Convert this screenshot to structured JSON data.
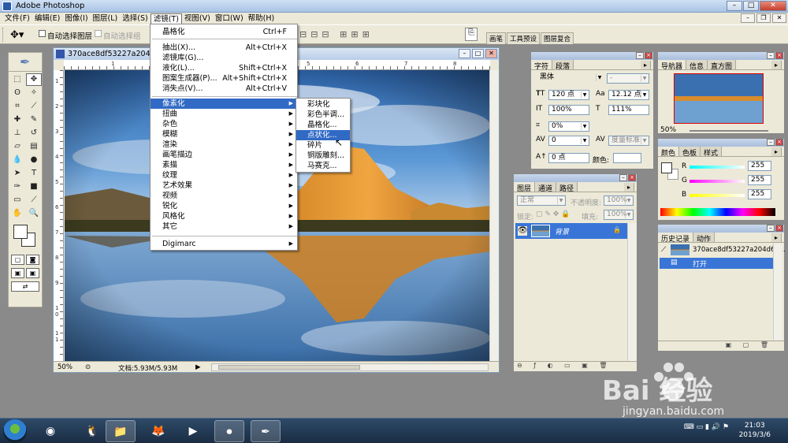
{
  "app": {
    "title": "Adobe Photoshop"
  },
  "menubar": {
    "items": [
      "文件(F)",
      "编辑(E)",
      "图像(I)",
      "图层(L)",
      "选择(S)",
      "滤镜(T)",
      "视图(V)",
      "窗口(W)",
      "帮助(H)"
    ],
    "active": "滤镜(T)"
  },
  "options": {
    "auto_select_layer": "自动选择图层",
    "auto_select_group": "自动选择组",
    "palette_tabs": [
      "画笔",
      "工具预设",
      "图层复合"
    ]
  },
  "document": {
    "title": "370ace8df53227a204d64...",
    "zoom": "50%",
    "doc_size": "文档:5.93M/5.93M",
    "ruler_top": [
      "1",
      "2",
      "3",
      "4",
      "5",
      "6",
      "7",
      "8"
    ],
    "ruler_left": [
      "1",
      "2",
      "3",
      "4",
      "5",
      "6",
      "7",
      "8",
      "9",
      "1 0",
      "1 1"
    ]
  },
  "filter_menu": {
    "items": [
      {
        "label": "晶格化",
        "shortcut": "Ctrl+F"
      },
      {
        "label": "抽出(X)...",
        "shortcut": "Alt+Ctrl+X"
      },
      {
        "label": "滤镜库(G)...",
        "shortcut": ""
      },
      {
        "label": "液化(L)...",
        "shortcut": "Shift+Ctrl+X"
      },
      {
        "label": "图案生成器(P)...",
        "shortcut": "Alt+Shift+Ctrl+X"
      },
      {
        "label": "消失点(V)...",
        "shortcut": "Alt+Ctrl+V"
      },
      {
        "label": "像素化",
        "shortcut": ""
      },
      {
        "label": "扭曲",
        "shortcut": ""
      },
      {
        "label": "杂色",
        "shortcut": ""
      },
      {
        "label": "模糊",
        "shortcut": ""
      },
      {
        "label": "渲染",
        "shortcut": ""
      },
      {
        "label": "画笔描边",
        "shortcut": ""
      },
      {
        "label": "素描",
        "shortcut": ""
      },
      {
        "label": "纹理",
        "shortcut": ""
      },
      {
        "label": "艺术效果",
        "shortcut": ""
      },
      {
        "label": "视频",
        "shortcut": ""
      },
      {
        "label": "锐化",
        "shortcut": ""
      },
      {
        "label": "风格化",
        "shortcut": ""
      },
      {
        "label": "其它",
        "shortcut": ""
      },
      {
        "label": "Digimarc",
        "shortcut": ""
      }
    ],
    "highlighted": "像素化"
  },
  "pixelate_submenu": {
    "items": [
      "彩块化",
      "彩色半调...",
      "晶格化...",
      "点状化...",
      "碎片",
      "铜版雕刻...",
      "马赛克..."
    ],
    "highlighted": "点状化..."
  },
  "character_panel": {
    "tabs": [
      "字符",
      "段落"
    ],
    "font_family": "黑体",
    "font_style": "-",
    "font_size": "120 点",
    "leading": "12.12 点",
    "vertical_scale": "100%",
    "horizontal_scale": "111%",
    "tracking_ratio": "0%",
    "kerning": "0",
    "kerning_mode": "度量标准",
    "baseline": "0 点",
    "color_label": "颜色:"
  },
  "navigator_panel": {
    "tabs": [
      "导航器",
      "信息",
      "直方图"
    ],
    "zoom": "50%"
  },
  "color_panel": {
    "tabs": [
      "颜色",
      "色板",
      "样式"
    ],
    "r_label": "R",
    "g_label": "G",
    "b_label": "B",
    "r": "255",
    "g": "255",
    "b": "255"
  },
  "layers_panel": {
    "tabs": [
      "图层",
      "通道",
      "路径"
    ],
    "blend_mode": "正常",
    "opacity_label": "不透明度:",
    "opacity": "100%",
    "lock_label": "锁定:",
    "fill_label": "填充:",
    "fill": "100%",
    "layer_name": "背景"
  },
  "history_panel": {
    "tabs": [
      "历史记录",
      "动作"
    ],
    "snapshot": "370ace8df53227a204d64...",
    "step": "打开"
  },
  "taskbar": {
    "time": "21:03",
    "date": "2019/3/6"
  },
  "watermark": {
    "text": "Bai 经验",
    "url": "jingyan.baidu.com"
  },
  "colors": {
    "menu_highlight": "#316ac5",
    "panel_bg": "#ece9d8",
    "workspace": "#8a8a8a"
  }
}
